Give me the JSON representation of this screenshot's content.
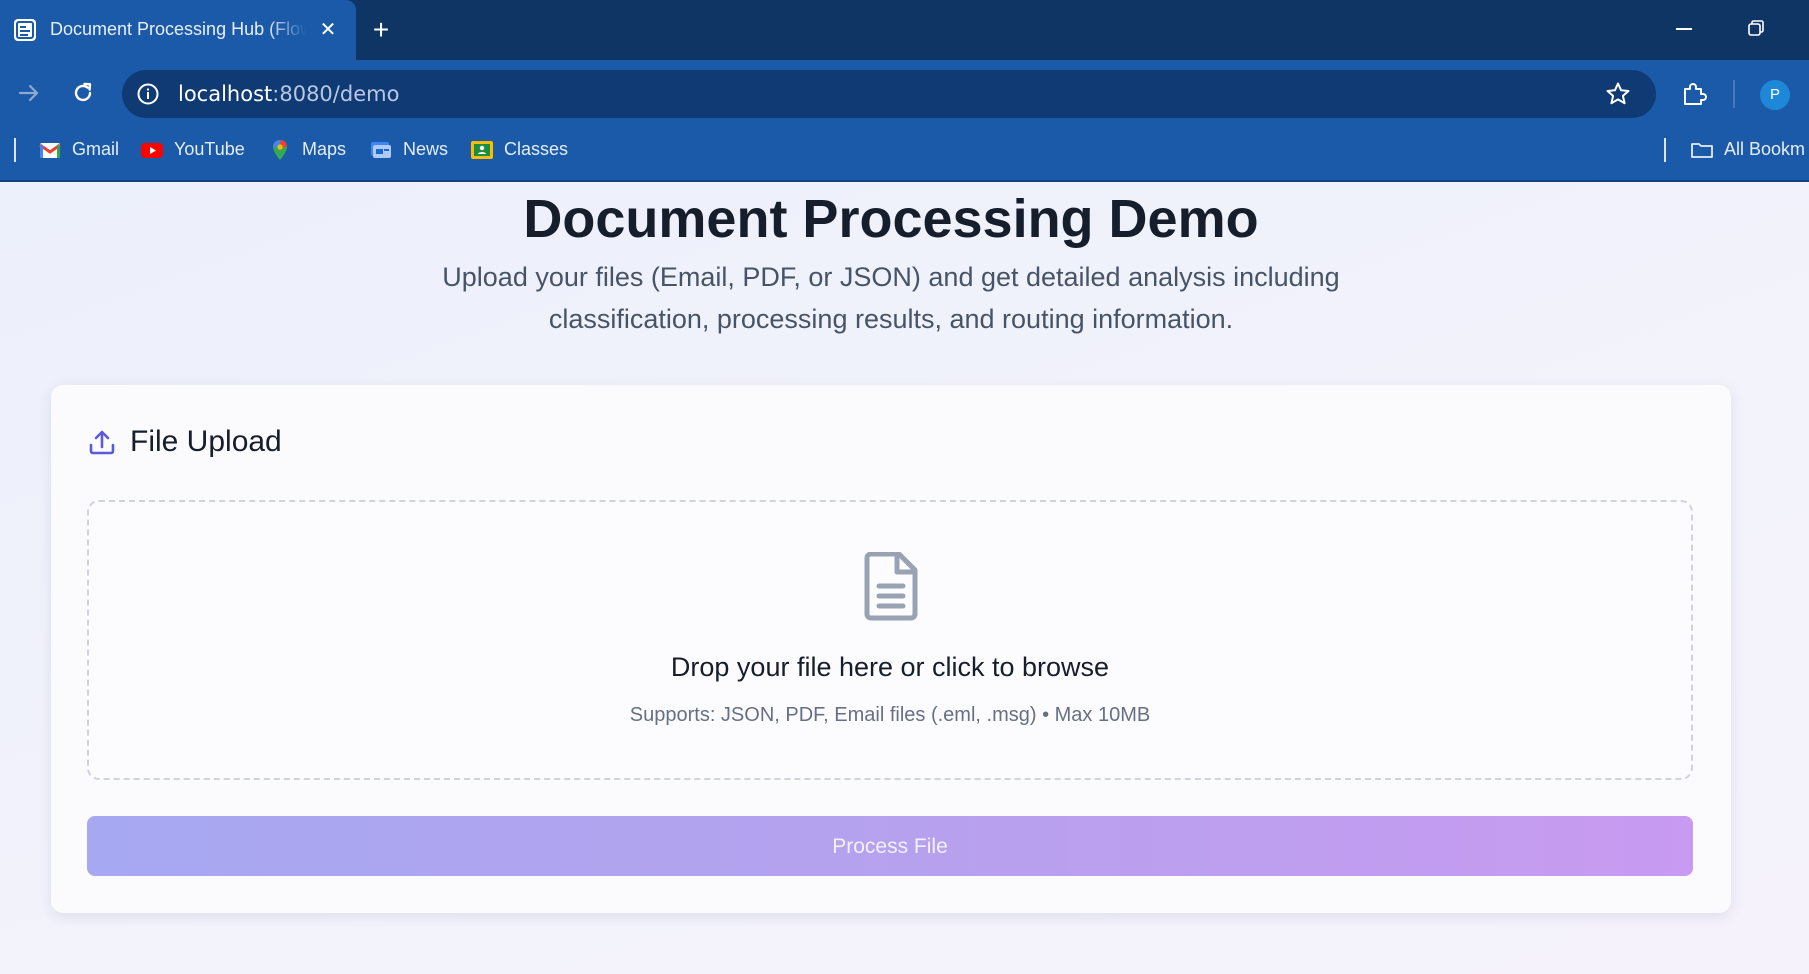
{
  "browser": {
    "tab_title": "Document Processing Hub (Flow",
    "tab_close": "✕",
    "new_tab": "+",
    "url_host": "localhost",
    "url_path": ":8080/demo",
    "profile_initial": "P",
    "bookmarks": [
      {
        "label": "Gmail",
        "icon": "gmail-icon"
      },
      {
        "label": "YouTube",
        "icon": "youtube-icon"
      },
      {
        "label": "Maps",
        "icon": "maps-icon"
      },
      {
        "label": "News",
        "icon": "news-icon"
      },
      {
        "label": "Classes",
        "icon": "classes-icon"
      }
    ],
    "all_bookmarks": "All Bookm"
  },
  "page": {
    "title": "Document Processing Demo",
    "subtitle": "Upload your files (Email, PDF, or JSON) and get detailed analysis including classification, processing results, and routing information."
  },
  "upload_card": {
    "title": "File Upload",
    "drop_title": "Drop your file here or click to browse",
    "drop_hint": "Supports: JSON, PDF, Email files (.eml, .msg) • Max 10MB",
    "button_label": "Process File"
  },
  "colors": {
    "chrome_dark": "#0f3564",
    "chrome_blue": "#1a5aa8",
    "accent_indigo": "#5b5bd6",
    "button_gradient_start": "#a6a8f1",
    "button_gradient_end": "#c89af1"
  }
}
